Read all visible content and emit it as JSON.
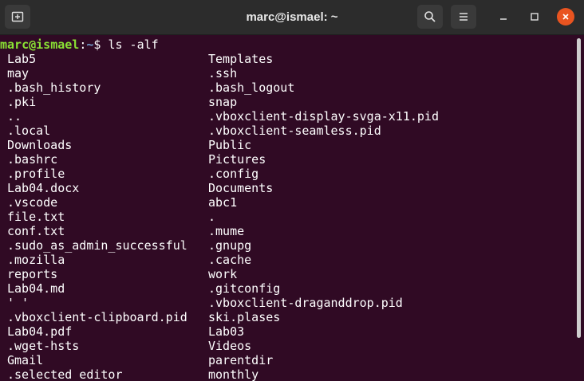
{
  "window": {
    "title": "marc@ismael: ~"
  },
  "prompt": {
    "user_host": "marc@ismael",
    "separator": ":",
    "path": "~",
    "symbol": "$ ",
    "command": "ls -alf"
  },
  "listing": {
    "rows": [
      {
        "left": "Lab5",
        "right": "Templates"
      },
      {
        "left": "may",
        "right": ".ssh"
      },
      {
        "left": ".bash_history",
        "right": ".bash_logout"
      },
      {
        "left": ".pki",
        "right": "snap"
      },
      {
        "left": "..",
        "right": ".vboxclient-display-svga-x11.pid"
      },
      {
        "left": ".local",
        "right": ".vboxclient-seamless.pid"
      },
      {
        "left": "Downloads",
        "right": "Public"
      },
      {
        "left": ".bashrc",
        "right": "Pictures"
      },
      {
        "left": ".profile",
        "right": ".config"
      },
      {
        "left": "Lab04.docx",
        "right": "Documents"
      },
      {
        "left": ".vscode",
        "right": "abc1"
      },
      {
        "left": "file.txt",
        "right": "."
      },
      {
        "left": "conf.txt",
        "right": ".mume"
      },
      {
        "left": ".sudo_as_admin_successful",
        "right": ".gnupg"
      },
      {
        "left": ".mozilla",
        "right": ".cache"
      },
      {
        "left": "reports",
        "right": "work"
      },
      {
        "left": "Lab04.md",
        "right": ".gitconfig"
      },
      {
        "left": "' '",
        "right": ".vboxclient-draganddrop.pid"
      },
      {
        "left": ".vboxclient-clipboard.pid",
        "right": "ski.plases"
      },
      {
        "left": "Lab04.pdf",
        "right": "Lab03"
      },
      {
        "left": ".wget-hsts",
        "right": "Videos"
      },
      {
        "left": "Gmail",
        "right": "parentdir"
      },
      {
        "left": ".selected_editor",
        "right": "monthly"
      }
    ]
  }
}
